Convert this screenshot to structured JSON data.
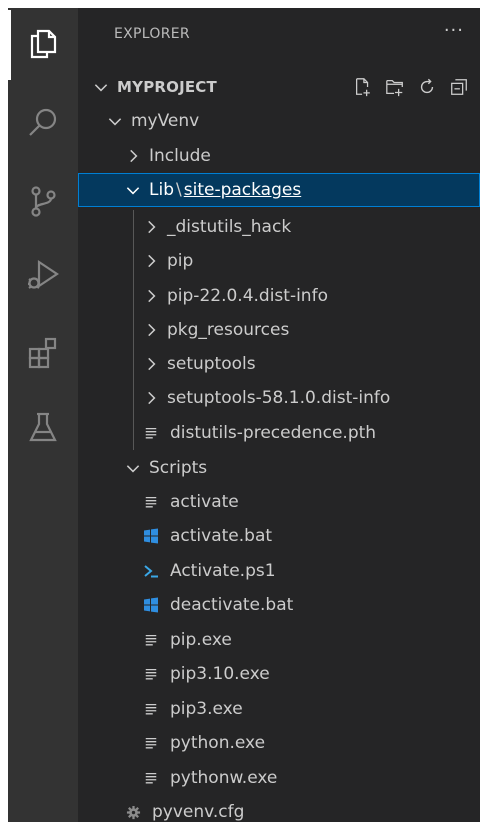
{
  "activity_bar": {
    "items": [
      {
        "name": "explorer",
        "icon": "files-icon",
        "active": true
      },
      {
        "name": "search",
        "icon": "search-icon"
      },
      {
        "name": "source-control",
        "icon": "source-control-icon"
      },
      {
        "name": "run-debug",
        "icon": "run-debug-icon"
      },
      {
        "name": "extensions",
        "icon": "extensions-icon"
      },
      {
        "name": "testing",
        "icon": "beaker-icon"
      }
    ]
  },
  "sidebar": {
    "title": "EXPLORER",
    "more": "···",
    "project": {
      "label": "MYPROJECT",
      "actions": [
        "new-file-icon",
        "new-folder-icon",
        "refresh-icon",
        "collapse-all-icon"
      ]
    },
    "tree": {
      "myvenv": "myVenv",
      "include": "Include",
      "lib": "Lib",
      "lib_sep": "\\",
      "site_packages": "site-packages",
      "distutils_hack": "_distutils_hack",
      "pip": "pip",
      "pip_dist_info": "pip-22.0.4.dist-info",
      "pkg_resources": "pkg_resources",
      "setuptools": "setuptools",
      "setuptools_dist_info": "setuptools-58.1.0.dist-info",
      "distutils_precedence": "distutils-precedence.pth",
      "scripts": "Scripts",
      "activate": "activate",
      "activate_bat": "activate.bat",
      "activate_ps1": "Activate.ps1",
      "deactivate_bat": "deactivate.bat",
      "pip_exe": "pip.exe",
      "pip310_exe": "pip3.10.exe",
      "pip3_exe": "pip3.exe",
      "python_exe": "python.exe",
      "pythonw_exe": "pythonw.exe",
      "pyvenv_cfg": "pyvenv.cfg"
    }
  },
  "colors": {
    "activity_bg": "#333333",
    "sidebar_bg": "#252526",
    "selection_bg": "#04395e",
    "selection_border": "#007fd4",
    "windows_blue": "#2f8ee0",
    "powershell_blue": "#3aa7e6"
  }
}
